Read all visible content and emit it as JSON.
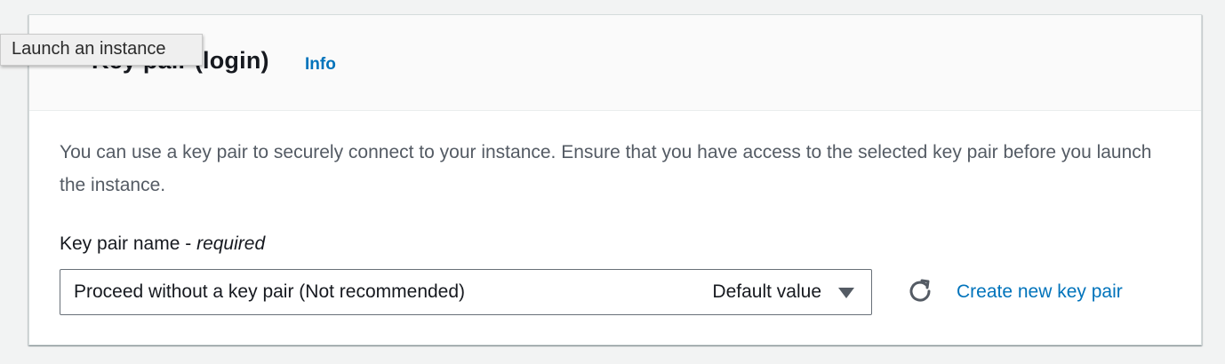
{
  "tooltip": {
    "text": "Launch an instance"
  },
  "section": {
    "title": "Key pair (login)",
    "info_link": "Info",
    "description": "You can use a key pair to securely connect to your instance. Ensure that you have access to the selected key pair before you launch the instance."
  },
  "key_pair_field": {
    "label": "Key pair name - ",
    "required_label": "required",
    "selected_value": "Proceed without a key pair (Not recommended)",
    "selected_tag": "Default value",
    "refresh_icon": "refresh-icon",
    "create_link": "Create new key pair"
  },
  "colors": {
    "link": "#0073bb",
    "background": "#f2f3f3",
    "header_background": "#fafafa",
    "text_secondary": "#545b64"
  }
}
